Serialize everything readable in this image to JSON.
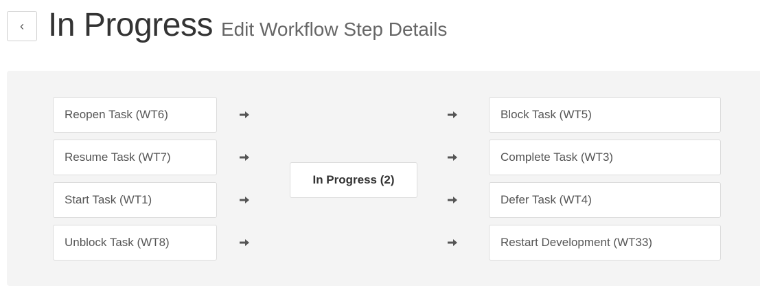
{
  "header": {
    "back_label": "‹",
    "title": "In Progress",
    "subtitle": "Edit Workflow Step Details"
  },
  "workflow": {
    "current_step": "In Progress (2)",
    "incoming": [
      {
        "label": "Reopen Task (WT6)"
      },
      {
        "label": "Resume Task (WT7)"
      },
      {
        "label": "Start Task (WT1)"
      },
      {
        "label": "Unblock Task (WT8)"
      }
    ],
    "outgoing": [
      {
        "label": "Block Task (WT5)"
      },
      {
        "label": "Complete Task (WT3)"
      },
      {
        "label": "Defer Task (WT4)"
      },
      {
        "label": "Restart Development (WT33)"
      }
    ],
    "arrow_icon": "arrow-right-icon"
  },
  "colors": {
    "panel_background": "#f4f4f4",
    "box_border": "#dcdcdc",
    "arrow": "#555555"
  }
}
